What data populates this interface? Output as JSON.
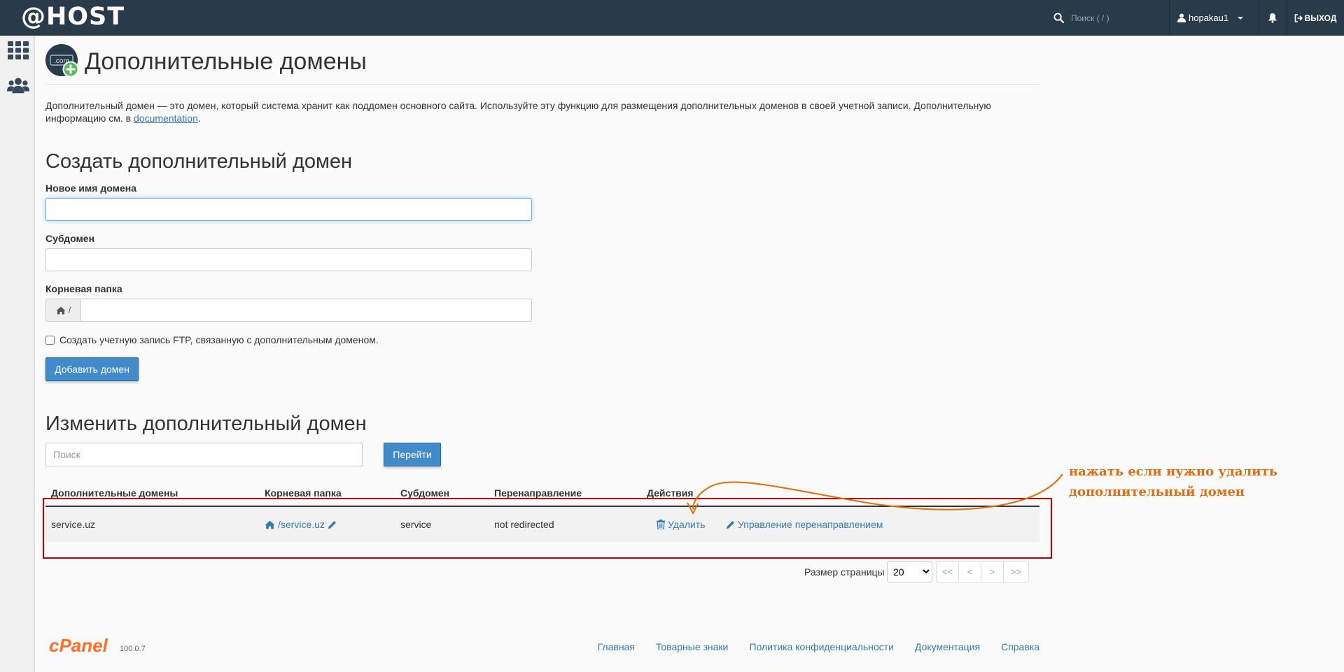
{
  "topbar": {
    "brand": "@HOST",
    "search_placeholder": "Поиск ( / )",
    "username": "hopakau1",
    "logout_label": "ВЫХОД"
  },
  "header": {
    "title": "Дополнительные домены",
    "logo_text": ".com",
    "description": "Дополнительный домен — это домен, который система хранит как поддомен основного сайта. Используйте эту функцию для размещения дополнительных доменов в своей учетной записи. Дополнительную информацию см. в",
    "doc_link": "documentation"
  },
  "create": {
    "heading": "Создать дополнительный домен",
    "new_domain_label": "Новое имя домена",
    "subdomain_label": "Субдомен",
    "root_label": "Корневая папка",
    "root_prefix": "/",
    "ftp_checkbox_label": "Создать учетную запись FTP, связанную с дополнительным доменом.",
    "submit_label": "Добавить домен"
  },
  "modify": {
    "heading": "Изменить дополнительный домен",
    "search_placeholder": "Поиск",
    "go_label": "Перейти",
    "columns": [
      "Дополнительные домены",
      "Корневая папка",
      "Субдомен",
      "Перенаправление",
      "Действия"
    ],
    "rows": [
      {
        "domain": "service.uz",
        "root": "/service.uz",
        "subdomain": "service",
        "redirect": "not redirected",
        "delete_label": "Удалить",
        "manage_redirect_label": "Управление перенаправлением"
      }
    ]
  },
  "pagination": {
    "page_size_label": "Размер страницы",
    "page_size": "20",
    "first": "<<",
    "prev": "<",
    "next": ">",
    "last": ">>"
  },
  "annotation": {
    "text": "нажать если нужно удалить дополнительный домен",
    "color": "#e36c0a",
    "box_color": "#c00000"
  },
  "footer": {
    "logo": "cPanel",
    "version": "100.0.7",
    "links": [
      "Главная",
      "Товарные знаки",
      "Политика конфиденциальности",
      "Документация",
      "Справка"
    ]
  },
  "colors": {
    "topbar": "#293a4a",
    "primary": "#428bca",
    "link": "#337ab7",
    "cpanel_orange": "#ff6c2c"
  }
}
